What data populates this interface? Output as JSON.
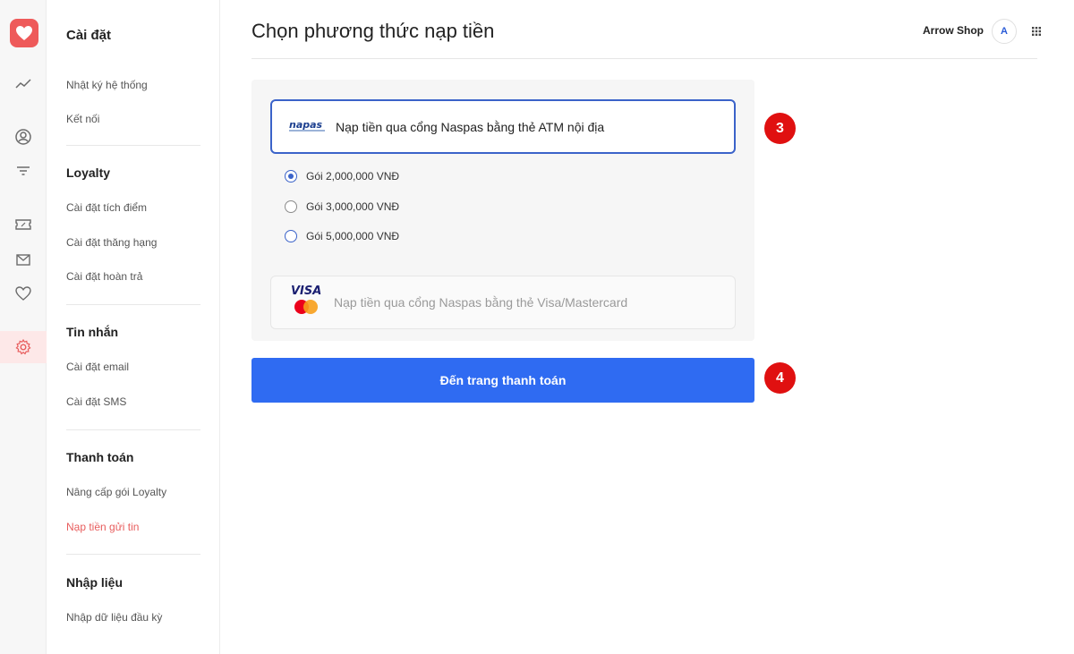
{
  "sidebar": {
    "title": "Cài đặt",
    "items": {
      "system_log": "Nhật ký hệ thống",
      "connect": "Kết nối"
    },
    "loyalty": {
      "title": "Loyalty",
      "points": "Cài đặt tích điểm",
      "rank": "Cài đặt thăng hạng",
      "refund": "Cài đặt hoàn trả"
    },
    "messages": {
      "title": "Tin nhắn",
      "email": "Cài đặt email",
      "sms": "Cài đặt SMS"
    },
    "payment": {
      "title": "Thanh toán",
      "upgrade": "Nâng cấp gói Loyalty",
      "topup": "Nạp tiền gửi tin"
    },
    "import": {
      "title": "Nhập liệu",
      "initial": "Nhập dữ liệu đầu kỳ"
    }
  },
  "header": {
    "title": "Chọn phương thức nạp tiền",
    "shop_name": "Arrow Shop",
    "avatar_letter": "A"
  },
  "methods": {
    "napas": {
      "logo_text": "napas",
      "label": "Nạp tiền qua cổng Naspas bằng thẻ ATM nội địa"
    },
    "visa": {
      "logo_text": "VISA",
      "label": "Nạp tiền qua cổng Naspas bằng thẻ Visa/Mastercard"
    }
  },
  "packages": [
    {
      "label": "Gói 2,000,000 VNĐ",
      "selected": true
    },
    {
      "label": "Gói 3,000,000 VNĐ",
      "selected": false
    },
    {
      "label": "Gói 5,000,000 VNĐ",
      "selected": false
    }
  ],
  "pay_button": "Đến trang thanh toán",
  "steps": {
    "method": "3",
    "pay": "4"
  },
  "colors": {
    "accent": "#2f6bf2",
    "brand": "#ee5a5a",
    "selected_border": "#3b63c9",
    "step_badge": "#e01010"
  },
  "icons": [
    "heart-logo-icon",
    "chart-icon",
    "user-circle-icon",
    "filter-icon",
    "ticket-icon",
    "mail-icon",
    "heart-icon",
    "gear-icon",
    "apps-grid-icon"
  ]
}
